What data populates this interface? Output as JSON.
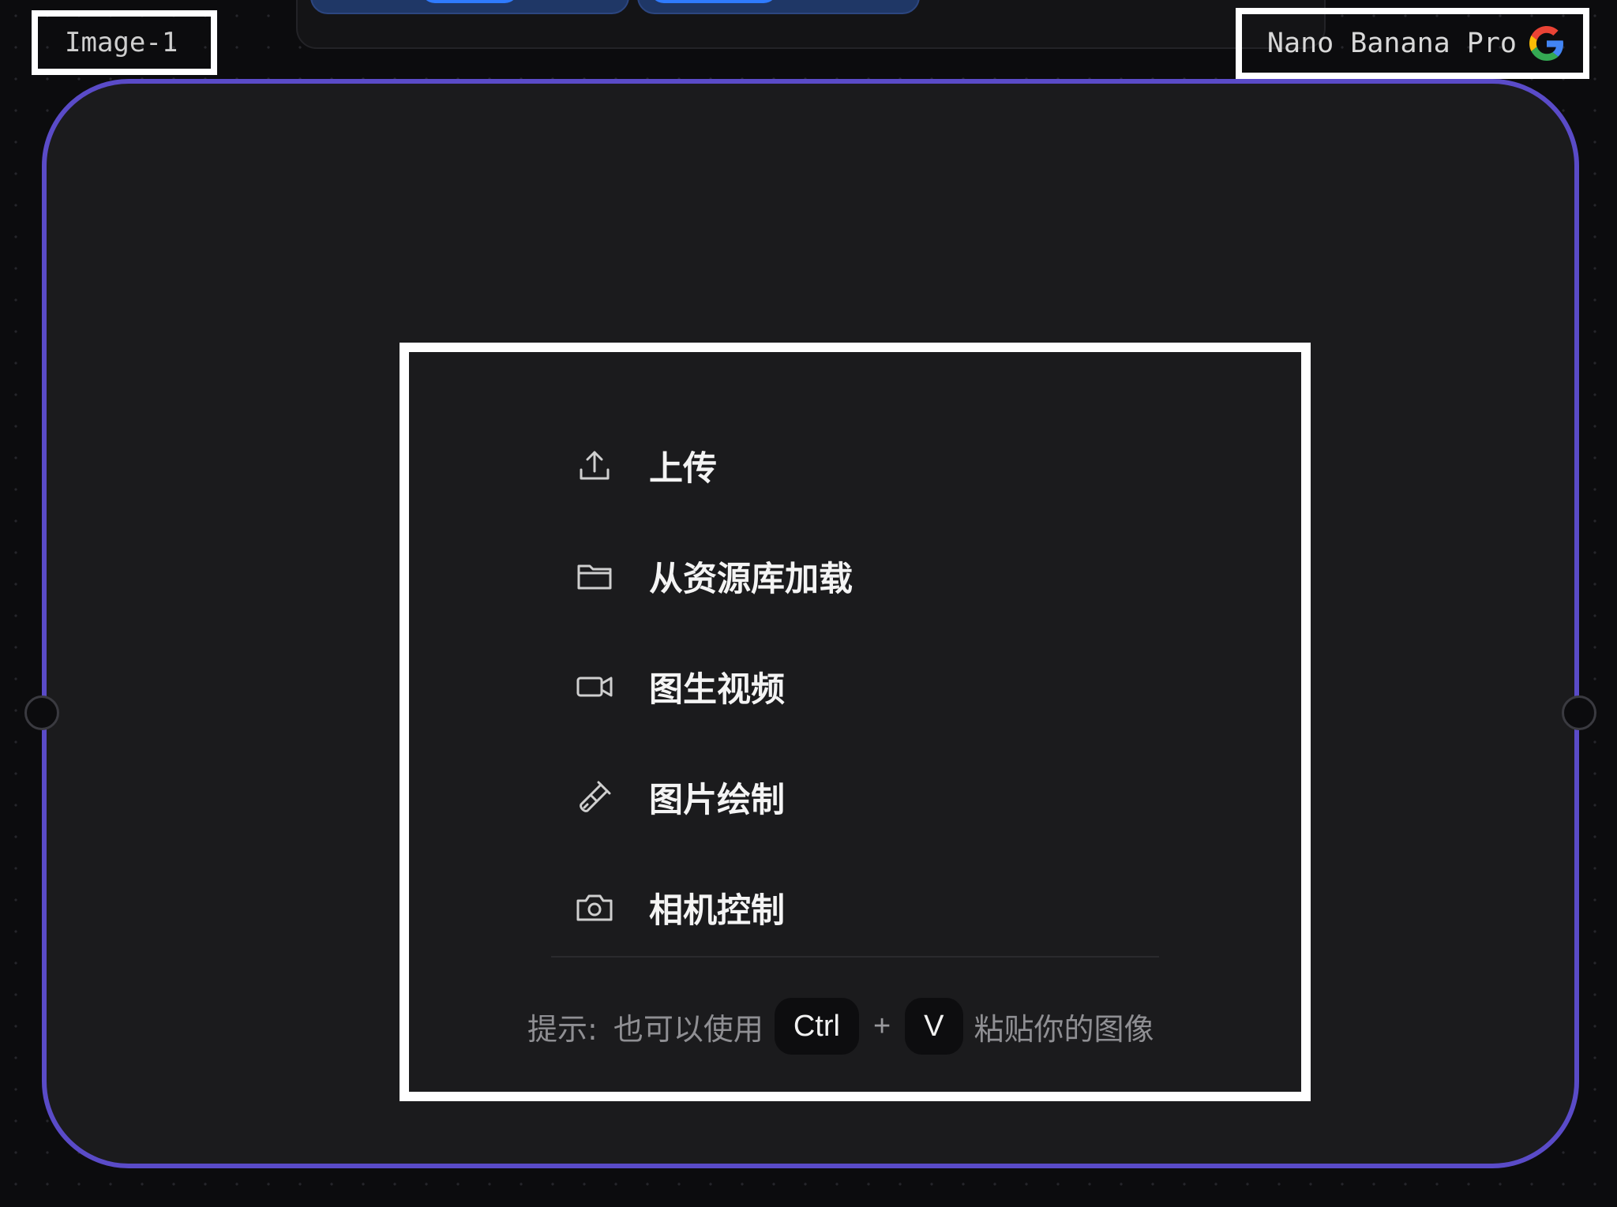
{
  "node": {
    "label": "Image-1",
    "model_name": "Nano Banana Pro",
    "model_logo": "google-g-logo"
  },
  "colors": {
    "node_border": "#5a4bc8",
    "toolbar_pill": "#2f7bff",
    "panel_bg": "#1b1b1d",
    "canvas_bg": "#0c0c0e"
  },
  "menu": {
    "items": [
      {
        "label": "上传",
        "icon": "upload-icon"
      },
      {
        "label": "从资源库加载",
        "icon": "folder-icon"
      },
      {
        "label": "图生视频",
        "icon": "video-camera-icon"
      },
      {
        "label": "图片绘制",
        "icon": "paint-brush-icon"
      },
      {
        "label": "相机控制",
        "icon": "camera-icon"
      }
    ]
  },
  "hint": {
    "prefix": "提示:",
    "text": "也可以使用",
    "key1": "Ctrl",
    "plus": "+",
    "key2": "V",
    "suffix": "粘贴你的图像"
  }
}
